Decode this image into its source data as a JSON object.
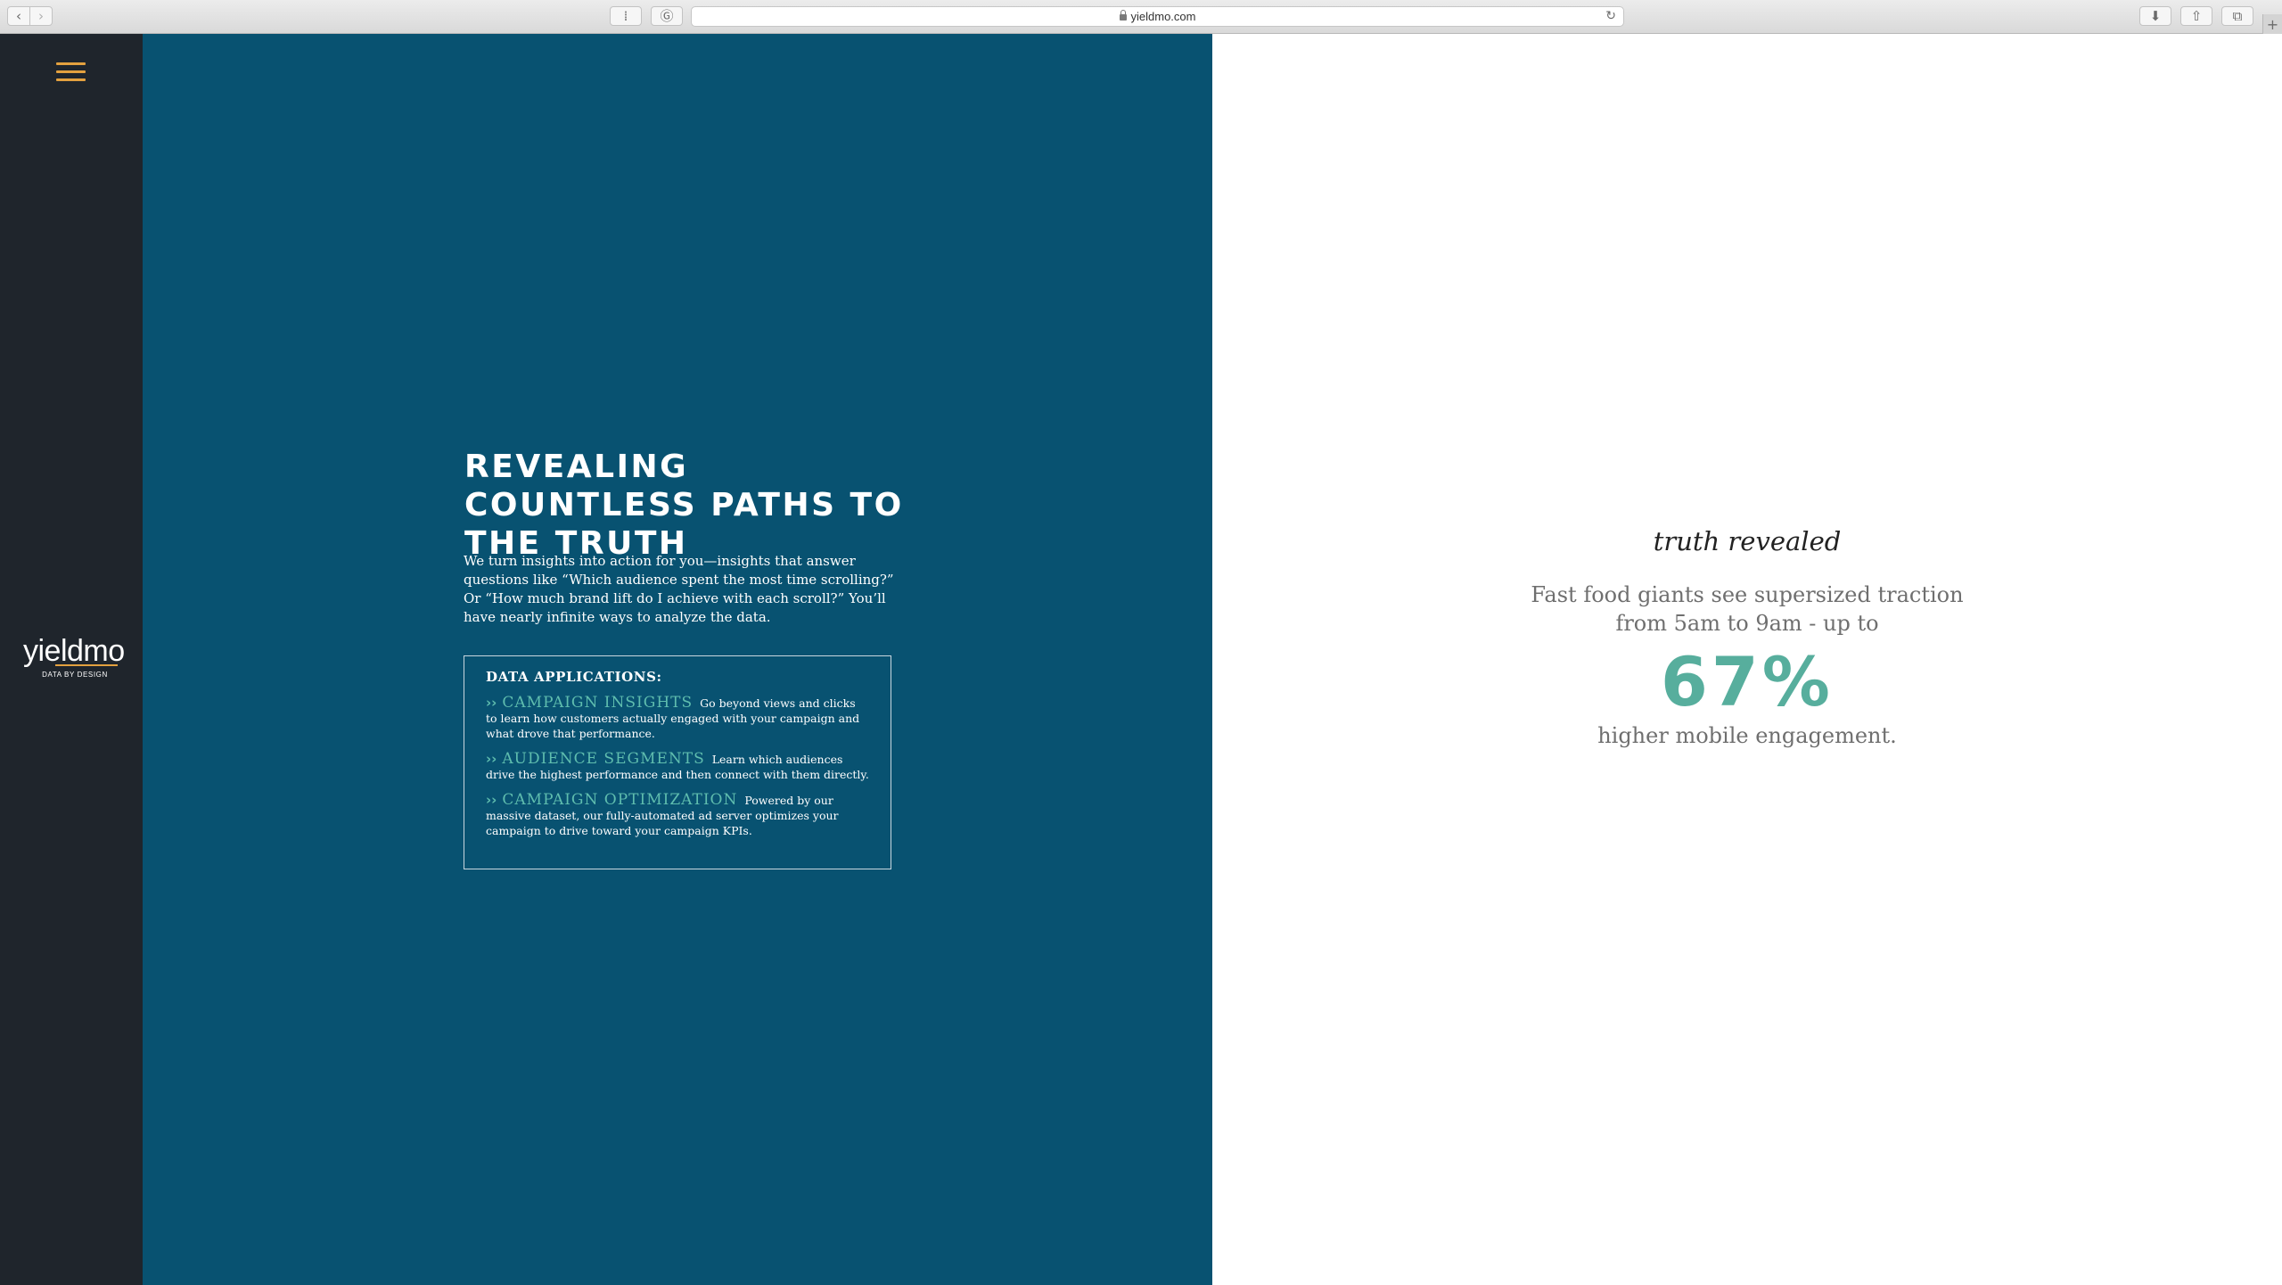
{
  "browser": {
    "url": "yieldmo.com",
    "icons": {
      "back": "back-chevron-icon",
      "forward": "forward-chevron-icon",
      "sidebar": "sidebar-toggle-icon",
      "extension1": "extension-icon",
      "extension2": "grammarly-icon",
      "reload": "reload-icon",
      "download": "download-icon",
      "share": "share-icon",
      "tabs": "tab-overview-icon",
      "new_tab": "plus-icon"
    },
    "glyphs": {
      "back": "‹",
      "forward": "›",
      "extension1": "⁞",
      "extension2": "Ⓖ",
      "reload": "↻",
      "download": "⬇",
      "share": "⇧",
      "tabs": "⧉",
      "new_tab": "+"
    }
  },
  "sidebar": {
    "menu_icon": "hamburger-menu-icon",
    "logo": {
      "wordmark": "yieldmo",
      "tagline": "DATA BY DESIGN"
    }
  },
  "hero": {
    "headline": "REVEALING COUNTLESS PATHS TO THE TRUTH",
    "intro": "We turn insights into action for you—insights that answer questions like “Which audience spent the most time scrolling?” Or “How much brand lift do I achieve with each scroll?” You’ll have nearly infinite ways to analyze the data.",
    "applications": {
      "title": "DATA APPLICATIONS:",
      "arrow": "››",
      "items": [
        {
          "name": "CAMPAIGN INSIGHTS",
          "description": "Go beyond views and clicks to learn how customers actually engaged with your campaign and what drove that performance."
        },
        {
          "name": "AUDIENCE SEGMENTS",
          "description": "Learn which audiences drive the highest performance and then connect with them directly."
        },
        {
          "name": "CAMPAIGN OPTIMIZATION",
          "description": "Powered by our massive dataset, our fully-automated ad server optimizes your campaign to drive toward your campaign KPIs."
        }
      ]
    }
  },
  "stat": {
    "kicker": "truth revealed",
    "text": "Fast food giants see supersized traction from 5am to 9am - up to",
    "number": "67%",
    "tail": "higher mobile engagement."
  },
  "colors": {
    "sidebar_bg": "#1f252c",
    "panel_bg": "#085271",
    "accent_orange": "#e3a13f",
    "accent_teal": "#57ae9d"
  }
}
